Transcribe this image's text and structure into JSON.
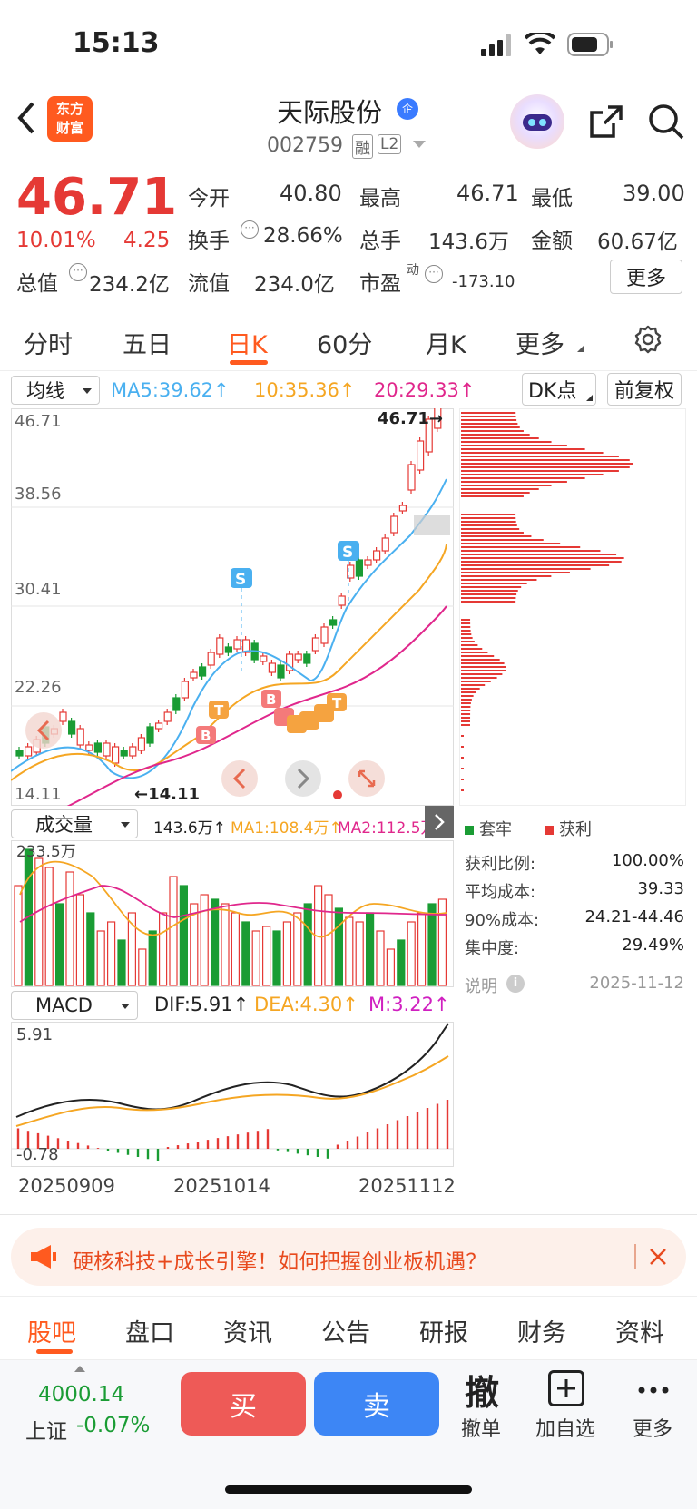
{
  "status_bar": {
    "time": "15:13"
  },
  "header": {
    "logo_line1": "东方",
    "logo_line2": "财富",
    "stock_name": "天际股份",
    "stock_code": "002759",
    "tag_rong": "融",
    "tag_l2": "L2",
    "badge": "企"
  },
  "quote": {
    "price": "46.71",
    "change_pct": "10.01%",
    "change_amt": "4.25",
    "open_label": "今开",
    "open": "40.80",
    "high_label": "最高",
    "high": "46.71",
    "low_label": "最低",
    "low": "39.00",
    "turnover_label": "换手",
    "turnover": "28.66%",
    "volume_label": "总手",
    "volume": "143.6万",
    "amount_label": "金额",
    "amount": "60.67亿",
    "mktcap_label": "总值",
    "mktcap": "234.2亿",
    "float_label": "流值",
    "float_cap": "234.0亿",
    "pe_label": "市盈",
    "pe_sup": "动",
    "pe": "-173.10",
    "more_btn": "更多"
  },
  "tabs": [
    "分时",
    "五日",
    "日K",
    "60分",
    "月K",
    "更多"
  ],
  "ma_bar": {
    "selector": "均线",
    "ma5": "MA5:39.62↑",
    "ma10": "10:35.36↑",
    "ma20": "20:29.33↑",
    "dk_btn": "DK点",
    "fq_btn": "前复权"
  },
  "kline": {
    "y_labels": [
      "46.71",
      "38.56",
      "30.41",
      "22.26",
      "14.11"
    ],
    "high_note": "46.71→",
    "low_note": "←14.11",
    "markers": [
      "S",
      "S",
      "B",
      "T",
      "B",
      "T"
    ]
  },
  "chip": {
    "legend_trapped": "套牢",
    "legend_profit": "获利",
    "stats": [
      {
        "k": "获利比例:",
        "v": "100.00%"
      },
      {
        "k": "平均成本:",
        "v": "39.33"
      },
      {
        "k": "90%成本:",
        "v": "24.21-44.46"
      },
      {
        "k": "集中度:",
        "v": "29.49%"
      }
    ],
    "note_label": "说明",
    "date": "2025-11-12"
  },
  "volume_bar": {
    "selector": "成交量",
    "vol": "143.6万↑",
    "ma1": "MA1:108.4万↑",
    "ma2": "MA2:112.5万",
    "max_label": "233.5万"
  },
  "macd_bar": {
    "selector": "MACD",
    "dif": "DIF:5.91↑",
    "dea": "DEA:4.30↑",
    "m": "M:3.22↑",
    "y_top": "5.91",
    "y_bottom": "-0.78"
  },
  "dates": [
    "20250909",
    "20251014",
    "20251112"
  ],
  "banner": {
    "text": "硬核科技+成长引擎！如何把握创业板机遇？"
  },
  "bottom_tabs": [
    "股吧",
    "盘口",
    "资讯",
    "公告",
    "研报",
    "财务",
    "资料"
  ],
  "footer": {
    "index_value": "4000.14",
    "index_name": "上证",
    "index_change": "-0.07%",
    "buy": "买",
    "sell": "卖",
    "cancel_icon": "撤",
    "cancel": "撤单",
    "add": "加自选",
    "more": "更多"
  },
  "colors": {
    "up": "#e53935",
    "down": "#1a9c34",
    "ma5": "#4ab0f0",
    "ma10": "#f5a623",
    "ma20": "#e0278c",
    "accent": "#ff5a1f"
  }
}
